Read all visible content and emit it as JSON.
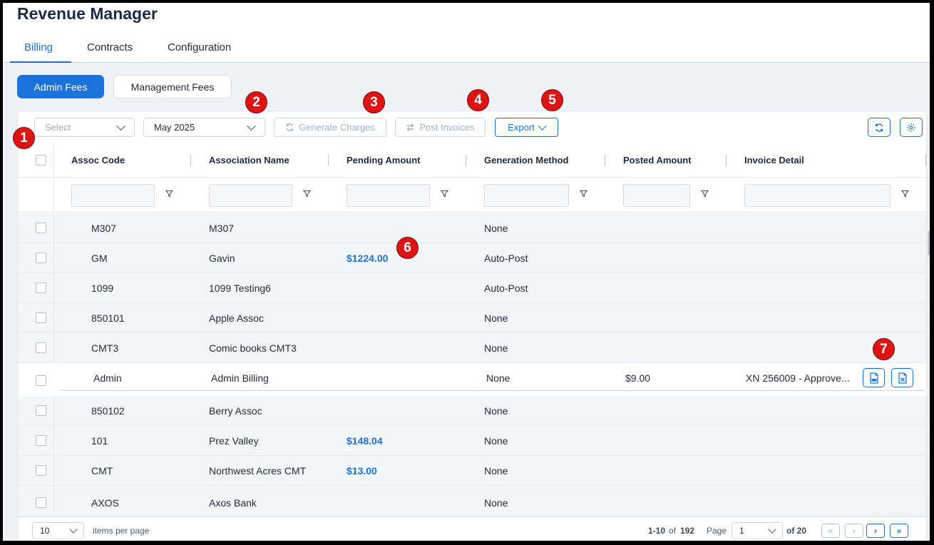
{
  "app": {
    "title": "Revenue Manager"
  },
  "tabs": [
    {
      "label": "Billing",
      "active": true
    },
    {
      "label": "Contracts",
      "active": false
    },
    {
      "label": "Configuration",
      "active": false
    }
  ],
  "fee_tabs": {
    "admin": "Admin Fees",
    "management": "Management Fees"
  },
  "toolbar": {
    "select_placeholder": "Select",
    "month_value": "May 2025",
    "generate_label": "Generate Charges",
    "post_label": "Post Invoices",
    "export_label": "Export"
  },
  "columns": [
    "Assoc Code",
    "Association Name",
    "Pending Amount",
    "Generation Method",
    "Posted Amount",
    "Invoice Detail"
  ],
  "rows": [
    {
      "code": "M307",
      "name": "M307",
      "pending": "",
      "method": "None",
      "posted": "",
      "invoice": ""
    },
    {
      "code": "GM",
      "name": "Gavin",
      "pending": "$1224.00",
      "method": "Auto-Post",
      "posted": "",
      "invoice": ""
    },
    {
      "code": "1099",
      "name": "1099 Testing6",
      "pending": "",
      "method": "Auto-Post",
      "posted": "",
      "invoice": ""
    },
    {
      "code": "850101",
      "name": "Apple Assoc",
      "pending": "",
      "method": "None",
      "posted": "",
      "invoice": ""
    },
    {
      "code": "CMT3",
      "name": "Comic books CMT3",
      "pending": "",
      "method": "None",
      "posted": "",
      "invoice": ""
    },
    {
      "code": "Admin",
      "name": "Admin Billing",
      "pending": "",
      "method": "None",
      "posted": "$9.00",
      "invoice": "XN 256009 - Approve..."
    },
    {
      "code": "850102",
      "name": "Berry Assoc",
      "pending": "",
      "method": "None",
      "posted": "",
      "invoice": ""
    },
    {
      "code": "101",
      "name": "Prez Valley",
      "pending": "$148.04",
      "method": "None",
      "posted": "",
      "invoice": ""
    },
    {
      "code": "CMT",
      "name": "Northwest Acres CMT",
      "pending": "$13.00",
      "method": "None",
      "posted": "",
      "invoice": ""
    },
    {
      "code": "AXOS",
      "name": "Axos Bank",
      "pending": "",
      "method": "None",
      "posted": "",
      "invoice": ""
    }
  ],
  "footer": {
    "page_size": "10",
    "items_per_page": "items per page",
    "range": "1-10",
    "of_label": "of",
    "total": "192",
    "page_label": "Page",
    "page_value": "1",
    "page_count": "of 20"
  },
  "badges": [
    "1",
    "2",
    "3",
    "4",
    "5",
    "6",
    "7"
  ],
  "colors": {
    "accent": "#1a73d9",
    "badge": "#dd1414",
    "row_bg": "#f3f6f9"
  },
  "icons": [
    "chevron-down-icon",
    "refresh-icon",
    "gear-icon",
    "filter-icon",
    "pdf-icon",
    "excel-icon",
    "first-page-icon",
    "prev-page-icon",
    "next-page-icon",
    "last-page-icon"
  ]
}
